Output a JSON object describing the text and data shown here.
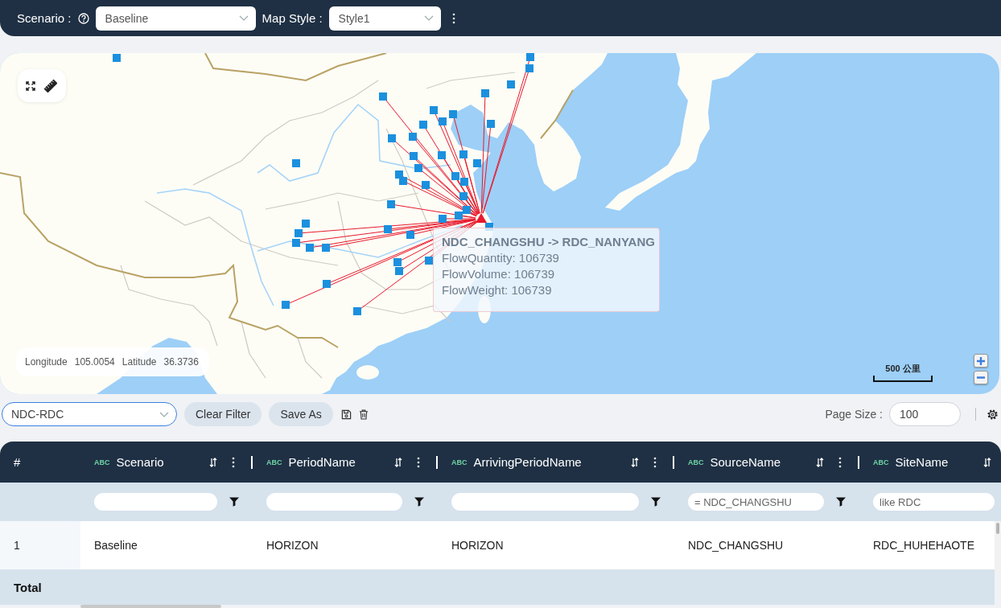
{
  "top_bar": {
    "scenario_label": "Scenario :",
    "scenario": "Baseline",
    "map_style_label": "Map Style :",
    "map_style": "Style1"
  },
  "map": {
    "coordinates": {
      "longitude_label": "Longitude",
      "longitude": "105.0054",
      "latitude_label": "Latitude",
      "latitude": "36.3736"
    },
    "scale_label": "500 公里",
    "tooltip": {
      "title": "NDC_CHANGSHU -> RDC_NANYANG",
      "lines": [
        "FlowQuantity: 106739",
        "FlowVolume: 106739",
        "FlowWeight: 106739"
      ]
    }
  },
  "view_bar": {
    "view": {
      "value": "NDC-RDC",
      "focused": true
    },
    "buttons": [
      "Clear Filter",
      "Save As"
    ],
    "page_size_label": "Page Size :",
    "page_size": "100"
  },
  "table": {
    "columns": [
      {
        "kind": "index",
        "label": "#"
      },
      {
        "kind": "text",
        "type_tag": "ABC",
        "label": "Scenario"
      },
      {
        "kind": "text",
        "type_tag": "ABC",
        "label": "PeriodName"
      },
      {
        "kind": "text",
        "type_tag": "ABC",
        "label": "ArrivingPeriodName"
      },
      {
        "kind": "text",
        "type_tag": "ABC",
        "label": "SourceName",
        "filter_value": "= NDC_CHANGSHU"
      },
      {
        "kind": "text",
        "type_tag": "ABC",
        "label": "SiteName",
        "filter_value": "like RDC"
      }
    ],
    "rows": [
      {
        "cells": [
          "1",
          "Baseline",
          "HORIZON",
          "HORIZON",
          "NDC_CHANGSHU",
          "RDC_HUHEHAOTE"
        ]
      }
    ],
    "total_label": "Total"
  }
}
